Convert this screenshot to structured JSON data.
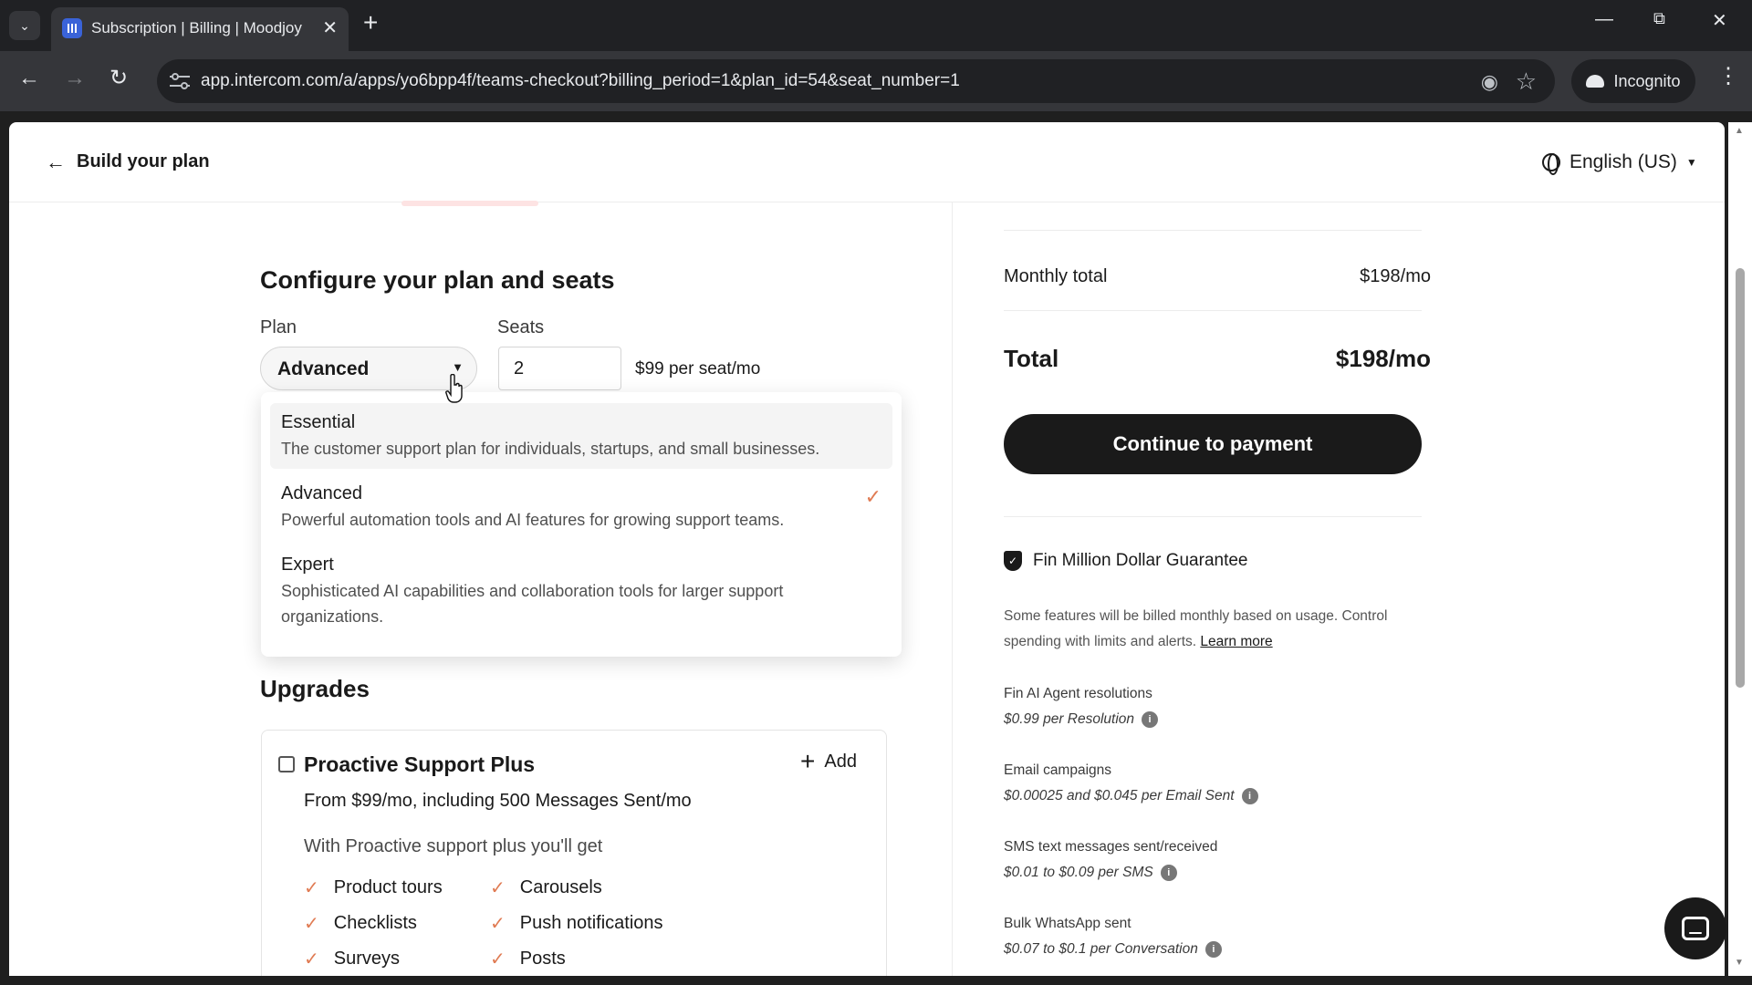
{
  "browser": {
    "tab_title": "Subscription | Billing | Moodjoy",
    "url": "app.intercom.com/a/apps/yo6bpp4f/teams-checkout?billing_period=1&plan_id=54&seat_number=1",
    "incognito_label": "Incognito"
  },
  "header": {
    "back_label": "Build your plan",
    "language": "English (US)"
  },
  "configure": {
    "title": "Configure your plan and seats",
    "plan_label": "Plan",
    "seats_label": "Seats",
    "selected_plan": "Advanced",
    "seats_value": "2",
    "seat_price": "$99 per seat/mo"
  },
  "plan_options": [
    {
      "name": "Essential",
      "description": "The customer support plan for individuals, startups, and small businesses.",
      "selected": false
    },
    {
      "name": "Advanced",
      "description": "Powerful automation tools and AI features for growing support teams.",
      "selected": true
    },
    {
      "name": "Expert",
      "description": "Sophisticated AI capabilities and collaboration tools for larger support organizations.",
      "selected": false
    }
  ],
  "upgrades": {
    "title": "Upgrades",
    "item": {
      "name": "Proactive Support Plus",
      "add_label": "Add",
      "price": "From $99/mo, including 500 Messages Sent/mo",
      "with_text": "With Proactive support plus you'll get",
      "features_col1": [
        "Product tours",
        "Checklists",
        "Surveys"
      ],
      "features_col2": [
        "Carousels",
        "Push notifications",
        "Posts"
      ]
    }
  },
  "summary": {
    "monthly_label": "Monthly total",
    "monthly_value": "$198/mo",
    "total_label": "Total",
    "total_value": "$198/mo",
    "pay_button": "Continue to payment",
    "guarantee": "Fin Million Dollar Guarantee",
    "usage_note": "Some features will be billed monthly based on usage. Control spending with limits and alerts.",
    "learn_more": "Learn more",
    "usage_items": [
      {
        "name": "Fin AI Agent resolutions",
        "price": "$0.99 per Resolution"
      },
      {
        "name": "Email campaigns",
        "price": "$0.00025 and $0.045 per Email Sent"
      },
      {
        "name": "SMS text messages sent/received",
        "price": "$0.01 to $0.09 per SMS"
      },
      {
        "name": "Bulk WhatsApp sent",
        "price": "$0.07 to $0.1 per Conversation"
      }
    ]
  },
  "colors": {
    "accent_check": "#e07b53",
    "primary_button": "#1a1a1a"
  }
}
